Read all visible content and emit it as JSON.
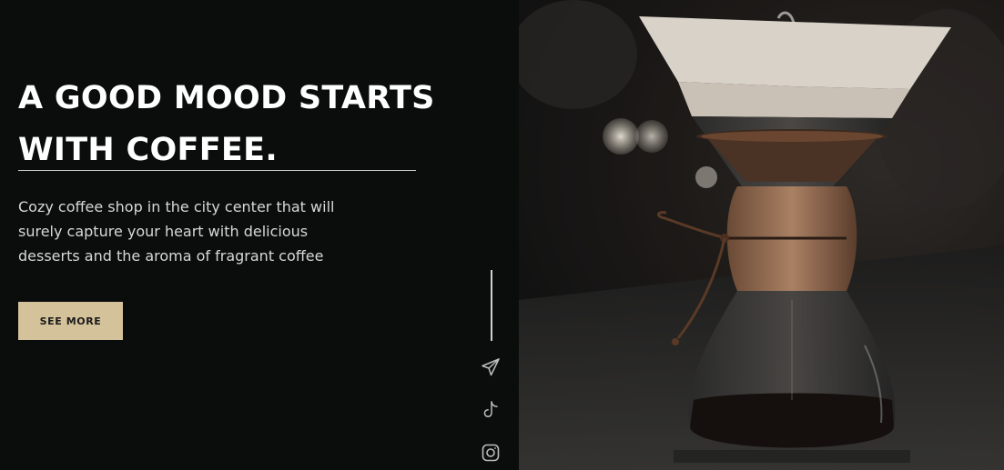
{
  "hero": {
    "headline_line1": "A GOOD MOOD STARTS",
    "headline_line2": "WITH COFFEE.",
    "description": "Cozy coffee shop in the city center that will surely capture your heart with delicious desserts and the aroma of fragrant coffee",
    "cta_label": "SEE MORE"
  },
  "social": {
    "items": [
      {
        "icon": "telegram-icon"
      },
      {
        "icon": "tiktok-icon"
      },
      {
        "icon": "instagram-icon"
      }
    ]
  },
  "colors": {
    "background": "#0b0d0d",
    "accent": "#d4c29a",
    "text": "#ffffff"
  }
}
